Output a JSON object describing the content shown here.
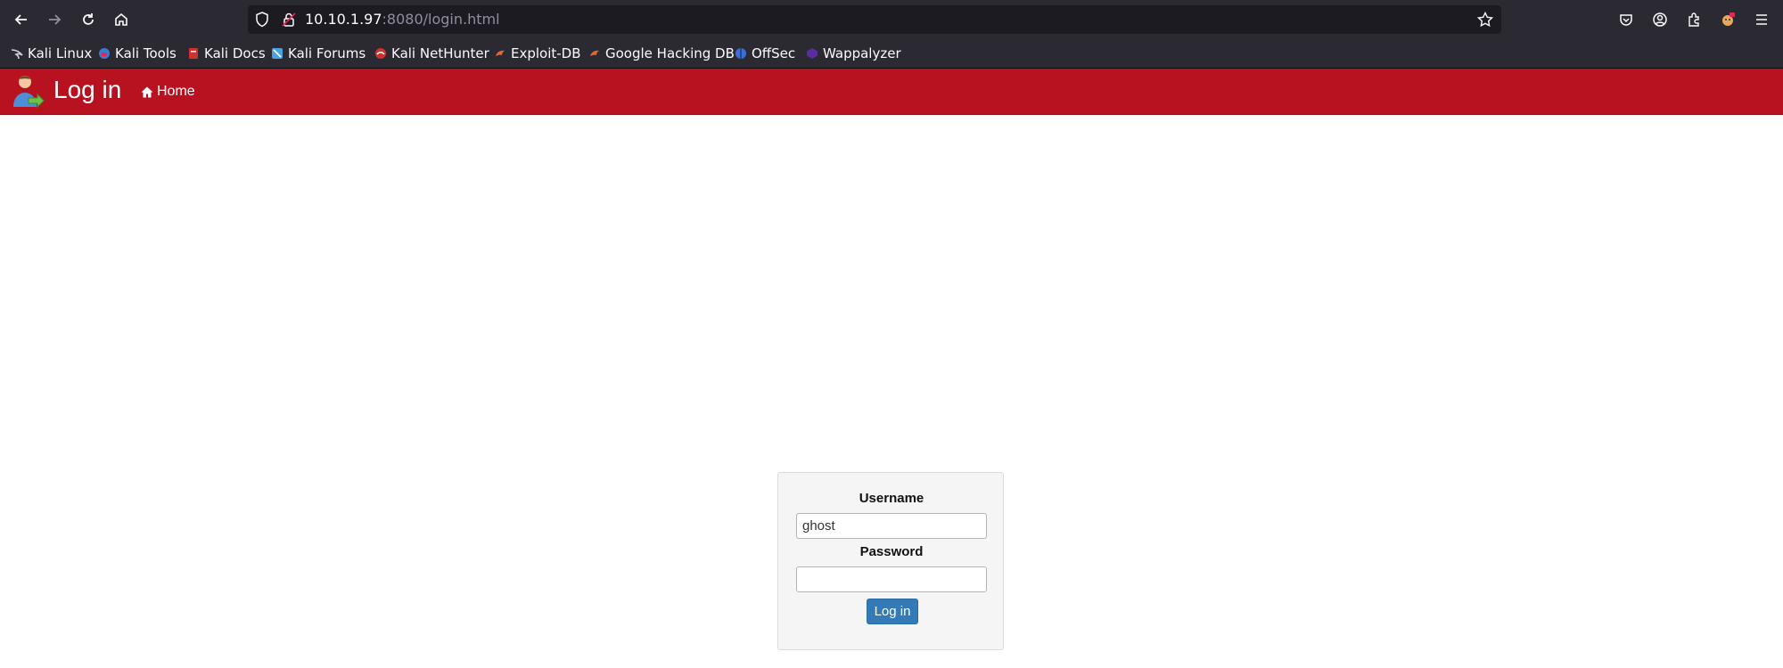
{
  "browser": {
    "url_host": "10.10.1.97",
    "url_rest": ":8080/login.html",
    "icons": [
      "back-icon",
      "forward-icon",
      "reload-icon",
      "home-icon",
      "shield-icon",
      "lock-icon",
      "star-icon",
      "pocket-icon",
      "account-icon",
      "extensions-icon",
      "profile-icon",
      "menu-icon"
    ]
  },
  "bookmarks": [
    {
      "label": "Kali Linux",
      "color": "#1a1a1a"
    },
    {
      "label": "Kali Tools",
      "color": "#3a7bd5"
    },
    {
      "label": "Kali Docs",
      "color": "#d0312d"
    },
    {
      "label": "Kali Forums",
      "color": "#4aa3df"
    },
    {
      "label": "Kali NetHunter",
      "color": "#d0312d"
    },
    {
      "label": "Exploit-DB",
      "color": "#e8642c"
    },
    {
      "label": "Google Hacking DB",
      "color": "#e8642c"
    },
    {
      "label": "OffSec",
      "color": "#3b6fd1"
    },
    {
      "label": "Wappalyzer",
      "color": "#5a2ca0"
    }
  ],
  "header": {
    "title": "Log in",
    "home_label": "Home",
    "background": "#b81221"
  },
  "login_form": {
    "username_label": "Username",
    "username_value": "ghost",
    "password_label": "Password",
    "password_value": "",
    "submit_label": "Log in",
    "button_color": "#337ab7"
  }
}
